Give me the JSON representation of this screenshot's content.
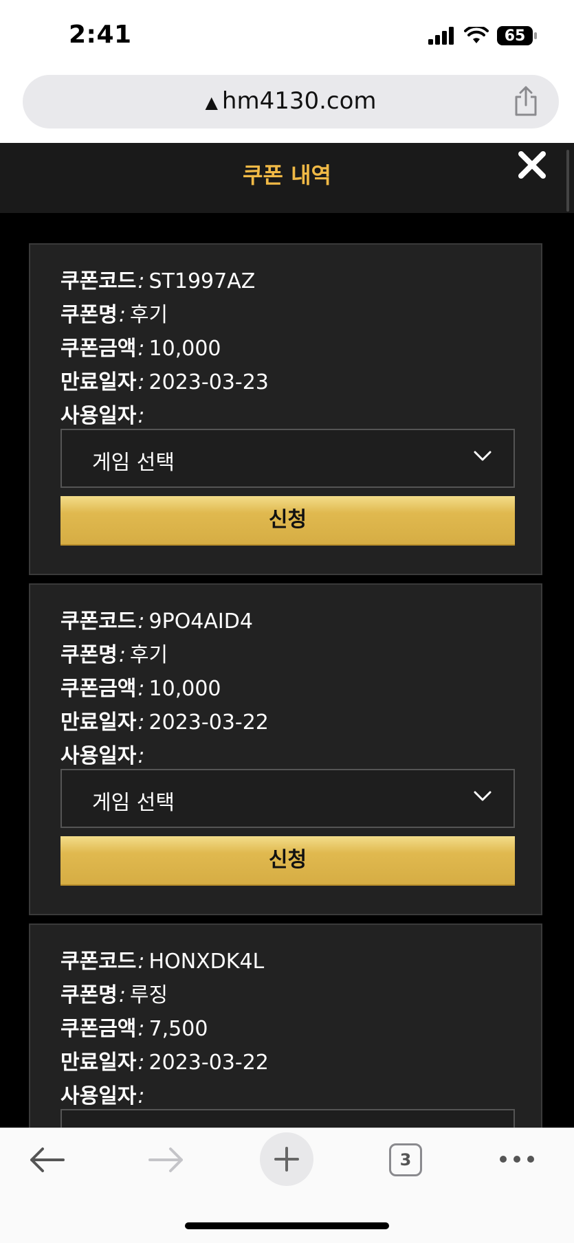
{
  "status_bar": {
    "time": "2:41",
    "battery": "65"
  },
  "browser": {
    "url": "hm4130.com"
  },
  "modal": {
    "title": "쿠폰 내역"
  },
  "labels": {
    "coupon_code": "쿠폰코드",
    "coupon_name": "쿠폰명",
    "coupon_amount": "쿠폰금액",
    "expiry_date": "만료일자",
    "used_date": "사용일자",
    "separator": ":"
  },
  "coupons": [
    {
      "code": "ST1997AZ",
      "name": "후기",
      "amount": "10,000",
      "expiry": "2023-03-23",
      "used": "",
      "select_value": "게임 선택",
      "apply_label": "신청"
    },
    {
      "code": "9PO4AID4",
      "name": "후기",
      "amount": "10,000",
      "expiry": "2023-03-22",
      "used": "",
      "select_value": "게임 선택",
      "apply_label": "신청"
    },
    {
      "code": "HONXDK4L",
      "name": "루징",
      "amount": "7,500",
      "expiry": "2023-03-22",
      "used": ""
    }
  ],
  "toolbar": {
    "tabs_count": "3"
  },
  "colors": {
    "title_accent": "#f0b946",
    "button_gold": "#d6ad44",
    "card_bg": "#222222"
  }
}
